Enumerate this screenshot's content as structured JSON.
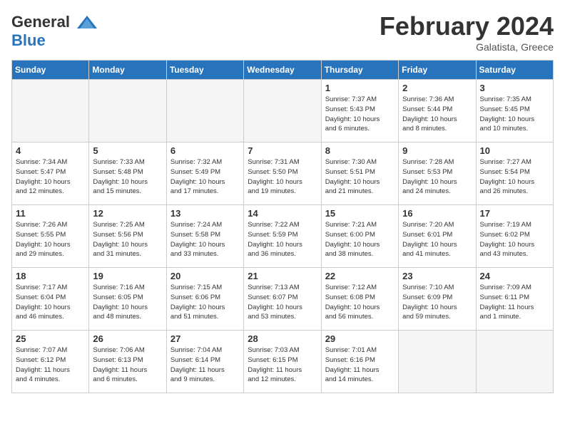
{
  "header": {
    "logo_line1": "General",
    "logo_line2": "Blue",
    "month_title": "February 2024",
    "location": "Galatista, Greece"
  },
  "days_of_week": [
    "Sunday",
    "Monday",
    "Tuesday",
    "Wednesday",
    "Thursday",
    "Friday",
    "Saturday"
  ],
  "weeks": [
    [
      {
        "num": "",
        "info": ""
      },
      {
        "num": "",
        "info": ""
      },
      {
        "num": "",
        "info": ""
      },
      {
        "num": "",
        "info": ""
      },
      {
        "num": "1",
        "info": "Sunrise: 7:37 AM\nSunset: 5:43 PM\nDaylight: 10 hours\nand 6 minutes."
      },
      {
        "num": "2",
        "info": "Sunrise: 7:36 AM\nSunset: 5:44 PM\nDaylight: 10 hours\nand 8 minutes."
      },
      {
        "num": "3",
        "info": "Sunrise: 7:35 AM\nSunset: 5:45 PM\nDaylight: 10 hours\nand 10 minutes."
      }
    ],
    [
      {
        "num": "4",
        "info": "Sunrise: 7:34 AM\nSunset: 5:47 PM\nDaylight: 10 hours\nand 12 minutes."
      },
      {
        "num": "5",
        "info": "Sunrise: 7:33 AM\nSunset: 5:48 PM\nDaylight: 10 hours\nand 15 minutes."
      },
      {
        "num": "6",
        "info": "Sunrise: 7:32 AM\nSunset: 5:49 PM\nDaylight: 10 hours\nand 17 minutes."
      },
      {
        "num": "7",
        "info": "Sunrise: 7:31 AM\nSunset: 5:50 PM\nDaylight: 10 hours\nand 19 minutes."
      },
      {
        "num": "8",
        "info": "Sunrise: 7:30 AM\nSunset: 5:51 PM\nDaylight: 10 hours\nand 21 minutes."
      },
      {
        "num": "9",
        "info": "Sunrise: 7:28 AM\nSunset: 5:53 PM\nDaylight: 10 hours\nand 24 minutes."
      },
      {
        "num": "10",
        "info": "Sunrise: 7:27 AM\nSunset: 5:54 PM\nDaylight: 10 hours\nand 26 minutes."
      }
    ],
    [
      {
        "num": "11",
        "info": "Sunrise: 7:26 AM\nSunset: 5:55 PM\nDaylight: 10 hours\nand 29 minutes."
      },
      {
        "num": "12",
        "info": "Sunrise: 7:25 AM\nSunset: 5:56 PM\nDaylight: 10 hours\nand 31 minutes."
      },
      {
        "num": "13",
        "info": "Sunrise: 7:24 AM\nSunset: 5:58 PM\nDaylight: 10 hours\nand 33 minutes."
      },
      {
        "num": "14",
        "info": "Sunrise: 7:22 AM\nSunset: 5:59 PM\nDaylight: 10 hours\nand 36 minutes."
      },
      {
        "num": "15",
        "info": "Sunrise: 7:21 AM\nSunset: 6:00 PM\nDaylight: 10 hours\nand 38 minutes."
      },
      {
        "num": "16",
        "info": "Sunrise: 7:20 AM\nSunset: 6:01 PM\nDaylight: 10 hours\nand 41 minutes."
      },
      {
        "num": "17",
        "info": "Sunrise: 7:19 AM\nSunset: 6:02 PM\nDaylight: 10 hours\nand 43 minutes."
      }
    ],
    [
      {
        "num": "18",
        "info": "Sunrise: 7:17 AM\nSunset: 6:04 PM\nDaylight: 10 hours\nand 46 minutes."
      },
      {
        "num": "19",
        "info": "Sunrise: 7:16 AM\nSunset: 6:05 PM\nDaylight: 10 hours\nand 48 minutes."
      },
      {
        "num": "20",
        "info": "Sunrise: 7:15 AM\nSunset: 6:06 PM\nDaylight: 10 hours\nand 51 minutes."
      },
      {
        "num": "21",
        "info": "Sunrise: 7:13 AM\nSunset: 6:07 PM\nDaylight: 10 hours\nand 53 minutes."
      },
      {
        "num": "22",
        "info": "Sunrise: 7:12 AM\nSunset: 6:08 PM\nDaylight: 10 hours\nand 56 minutes."
      },
      {
        "num": "23",
        "info": "Sunrise: 7:10 AM\nSunset: 6:09 PM\nDaylight: 10 hours\nand 59 minutes."
      },
      {
        "num": "24",
        "info": "Sunrise: 7:09 AM\nSunset: 6:11 PM\nDaylight: 11 hours\nand 1 minute."
      }
    ],
    [
      {
        "num": "25",
        "info": "Sunrise: 7:07 AM\nSunset: 6:12 PM\nDaylight: 11 hours\nand 4 minutes."
      },
      {
        "num": "26",
        "info": "Sunrise: 7:06 AM\nSunset: 6:13 PM\nDaylight: 11 hours\nand 6 minutes."
      },
      {
        "num": "27",
        "info": "Sunrise: 7:04 AM\nSunset: 6:14 PM\nDaylight: 11 hours\nand 9 minutes."
      },
      {
        "num": "28",
        "info": "Sunrise: 7:03 AM\nSunset: 6:15 PM\nDaylight: 11 hours\nand 12 minutes."
      },
      {
        "num": "29",
        "info": "Sunrise: 7:01 AM\nSunset: 6:16 PM\nDaylight: 11 hours\nand 14 minutes."
      },
      {
        "num": "",
        "info": ""
      },
      {
        "num": "",
        "info": ""
      }
    ]
  ]
}
